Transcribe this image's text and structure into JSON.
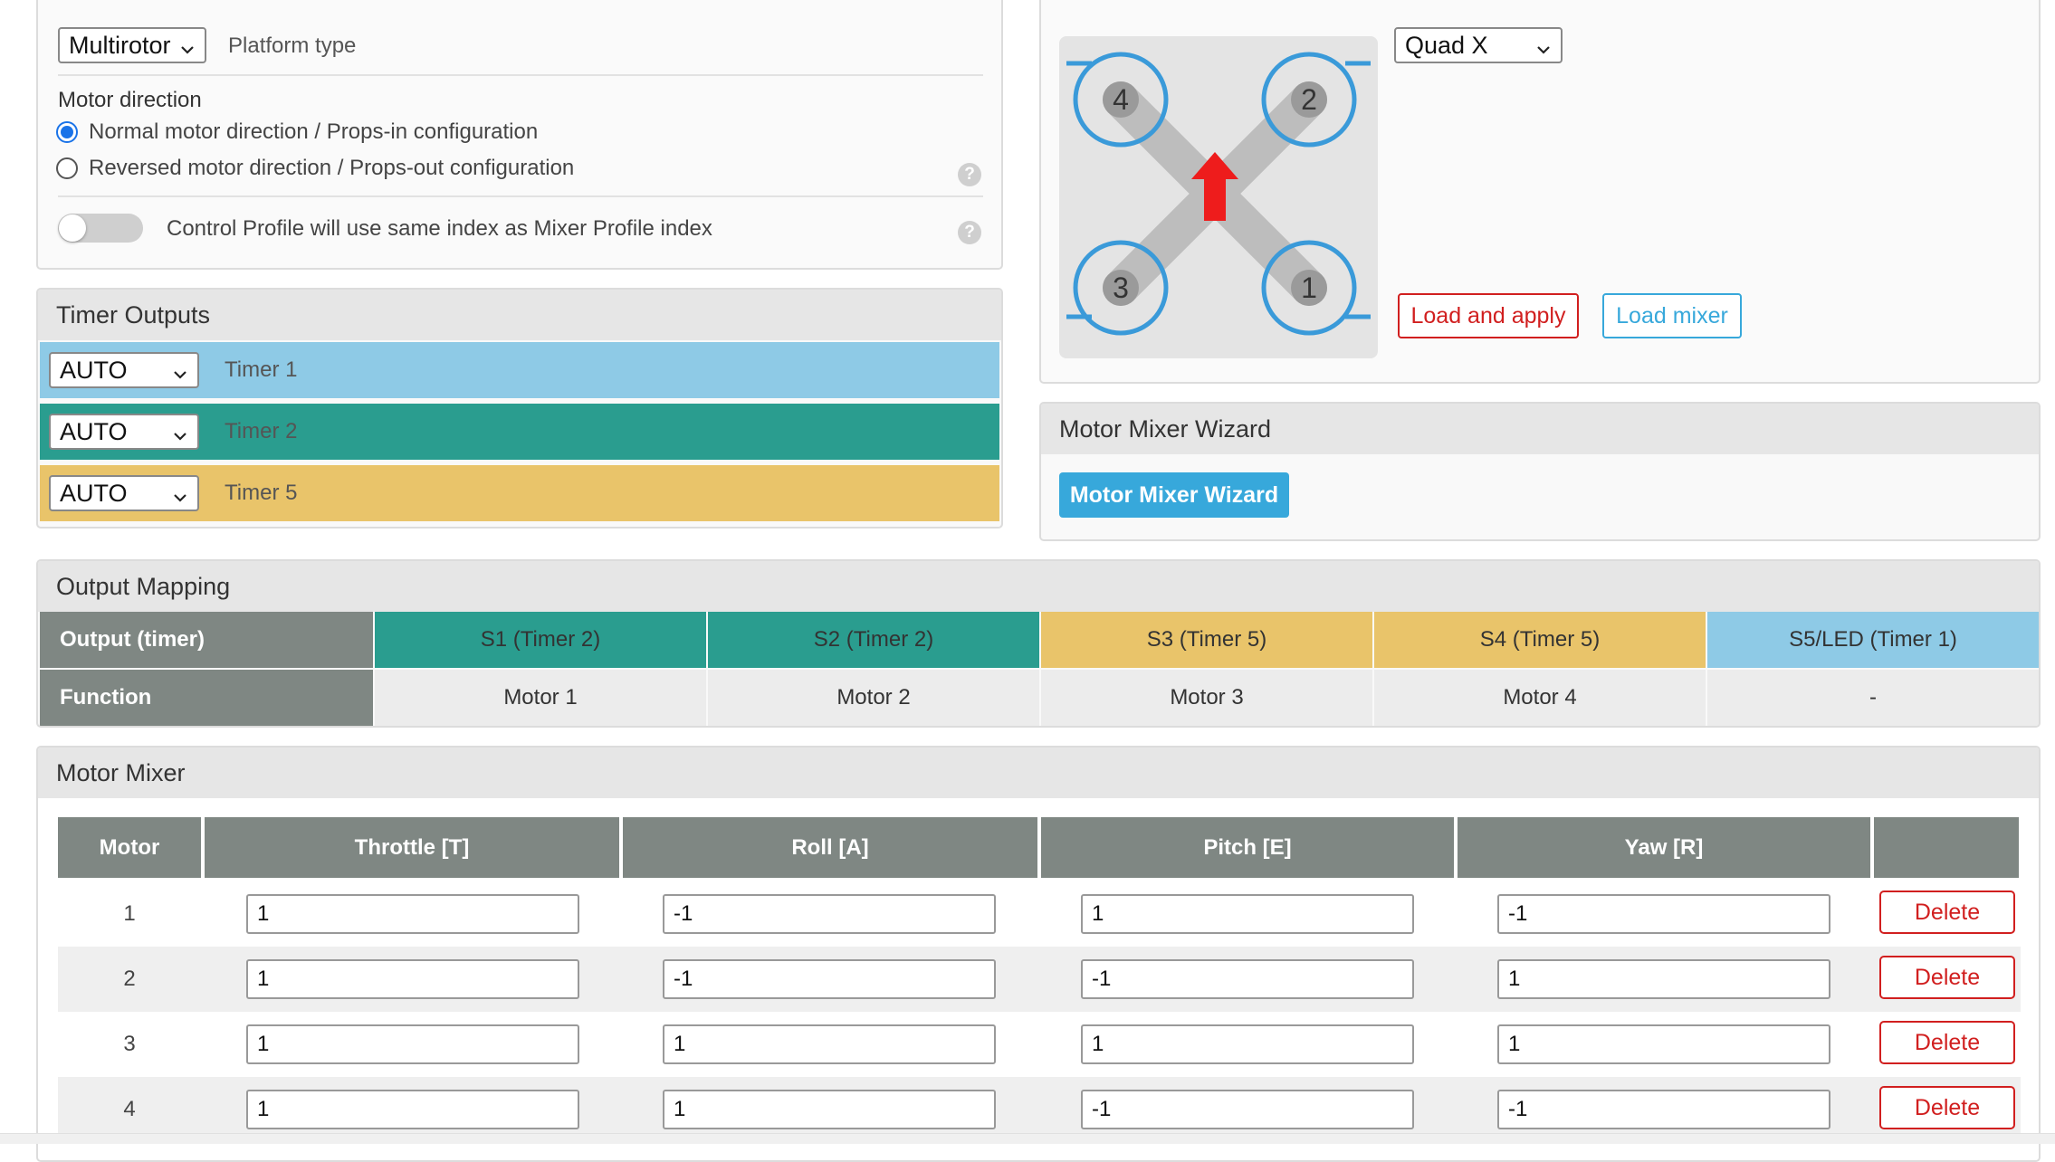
{
  "platform": {
    "select_value": "Multirotor",
    "label": "Platform type"
  },
  "motor_direction": {
    "title": "Motor direction",
    "options": [
      {
        "label": "Normal motor direction / Props-in configuration",
        "selected": true
      },
      {
        "label": "Reversed motor direction / Props-out configuration",
        "selected": false
      }
    ],
    "help": "?"
  },
  "control_profile": {
    "label": "Control Profile will use same index as Mixer Profile index",
    "enabled": false,
    "help": "?"
  },
  "timer_outputs": {
    "title": "Timer Outputs",
    "rows": [
      {
        "value": "AUTO",
        "label": "Timer 1",
        "color": "#8ecae6"
      },
      {
        "value": "AUTO",
        "label": "Timer 2",
        "color": "#2a9d8f"
      },
      {
        "value": "AUTO",
        "label": "Timer 5",
        "color": "#e9c46a"
      }
    ]
  },
  "mixer_preview": {
    "preset_value": "Quad X",
    "motor_labels": [
      "4",
      "2",
      "3",
      "1"
    ],
    "load_apply_label": "Load and apply",
    "load_mixer_label": "Load mixer"
  },
  "wizard": {
    "title": "Motor Mixer Wizard",
    "button_label": "Motor Mixer Wizard"
  },
  "output_mapping": {
    "title": "Output Mapping",
    "header_label": "Output (timer)",
    "function_label": "Function",
    "outputs": [
      {
        "name": "S1 (Timer 2)",
        "function": "Motor 1",
        "color": "#2a9d8f"
      },
      {
        "name": "S2 (Timer 2)",
        "function": "Motor 2",
        "color": "#2a9d8f"
      },
      {
        "name": "S3 (Timer 5)",
        "function": "Motor 3",
        "color": "#e9c46a"
      },
      {
        "name": "S4 (Timer 5)",
        "function": "Motor 4",
        "color": "#e9c46a"
      },
      {
        "name": "S5/LED (Timer 1)",
        "function": "-",
        "color": "#8ecae6"
      }
    ]
  },
  "motor_mixer": {
    "title": "Motor Mixer",
    "columns": [
      "Motor",
      "Throttle [T]",
      "Roll [A]",
      "Pitch [E]",
      "Yaw [R]"
    ],
    "delete_label": "Delete",
    "rows": [
      {
        "motor": "1",
        "throttle": "1",
        "roll": "-1",
        "pitch": "1",
        "yaw": "-1"
      },
      {
        "motor": "2",
        "throttle": "1",
        "roll": "-1",
        "pitch": "-1",
        "yaw": "1"
      },
      {
        "motor": "3",
        "throttle": "1",
        "roll": "1",
        "pitch": "1",
        "yaw": "1"
      },
      {
        "motor": "4",
        "throttle": "1",
        "roll": "1",
        "pitch": "-1",
        "yaw": "-1"
      }
    ]
  }
}
